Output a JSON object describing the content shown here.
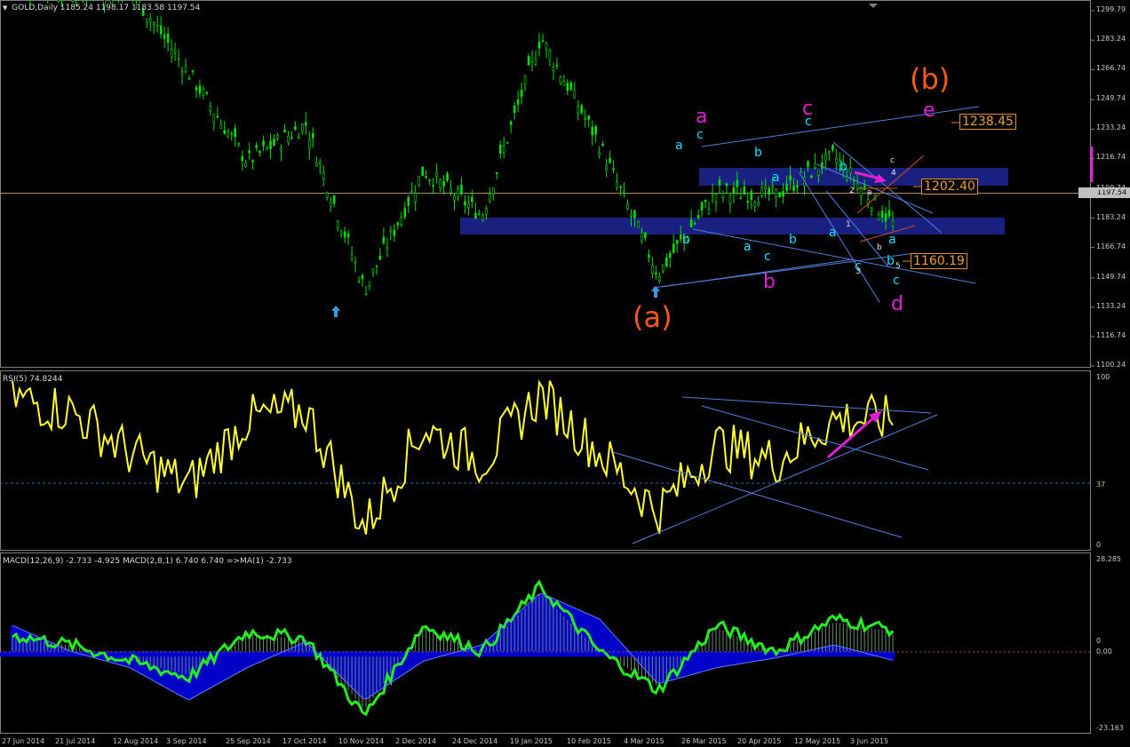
{
  "header": {
    "symbol_label": "GOLD,Daily",
    "ohlc": "1185.24 1198.17 1183.58 1197.54",
    "current_price": "1197.54"
  },
  "price_axis": [
    "1299.79",
    "1283.24",
    "1266.74",
    "1249.74",
    "1233.24",
    "1216.74",
    "1199.74",
    "1183.24",
    "1166.74",
    "1149.74",
    "1133.24",
    "1116.74",
    "1100.24"
  ],
  "date_axis": [
    "27 Jun 2014",
    "21 Jul 2014",
    "12 Aug 2014",
    "3 Sep 2014",
    "25 Sep 2014",
    "17 Oct 2014",
    "10 Nov 2014",
    "2 Dec 2014",
    "24 Dec 2014",
    "19 Jan 2015",
    "10 Feb 2015",
    "4 Mar 2015",
    "26 Mar 2015",
    "20 Apr 2015",
    "12 May 2015",
    "3 Jun 2015"
  ],
  "rsi": {
    "header": "RSI(5) 74.8244",
    "ticks": [
      "100",
      "37",
      "0"
    ]
  },
  "macd": {
    "header": "MACD(12,26,9) -2.733 -4.925  MACD(2,8,1) 6.740 6.740  =>MA(1) -2.733",
    "ticks": [
      "28.285",
      "0",
      "0.00",
      "-23.163"
    ]
  },
  "price_tags": [
    "1238.45",
    "1202.40",
    "1160.19"
  ],
  "annotations": {
    "wave_a_big": "(a)",
    "wave_b_big": "(b)",
    "magenta": [
      "a",
      "c",
      "b",
      "d",
      "e"
    ],
    "cyan": [
      "a",
      "c",
      "b",
      "b",
      "a",
      "a",
      "c",
      "b",
      "c",
      "a",
      "b",
      "c",
      "b",
      "a",
      "c"
    ],
    "small": [
      "c",
      "4",
      "2",
      "a",
      "1",
      "b",
      "3",
      "5"
    ]
  },
  "colors": {
    "candle": "#00e000",
    "rsi": "#ffff33",
    "macd_fast": "#22ee22",
    "macd_hist": "#0000cc",
    "trend": "#4f7fdb",
    "zone": "#1a2080",
    "wave_big": "#ff5a14",
    "wave_magenta": "#e020d0",
    "wave_cyan": "#00e0ff"
  },
  "chart_data": [
    {
      "type": "candlestick",
      "title": "GOLD,Daily",
      "ylim": [
        1100.24,
        1299.79
      ],
      "x": [
        "27 Jun 2014",
        "21 Jul 2014",
        "12 Aug 2014",
        "3 Sep 2014",
        "25 Sep 2014",
        "17 Oct 2014",
        "10 Nov 2014",
        "2 Dec 2014",
        "24 Dec 2014",
        "19 Jan 2015",
        "10 Feb 2015",
        "4 Mar 2015",
        "26 Mar 2015",
        "20 Apr 2015",
        "12 May 2015",
        "3 Jun 2015"
      ],
      "close": [
        1316,
        1310,
        1312,
        1265,
        1215,
        1236,
        1143,
        1210,
        1185,
        1285,
        1225,
        1152,
        1198,
        1196,
        1218,
        1180
      ],
      "last_close": 1197.54
    },
    {
      "type": "line",
      "title": "RSI(5) 74.8244",
      "ylim": [
        0,
        100
      ],
      "x": [
        "27 Jun 2014",
        "21 Jul 2014",
        "12 Aug 2014",
        "3 Sep 2014",
        "25 Sep 2014",
        "17 Oct 2014",
        "10 Nov 2014",
        "2 Dec 2014",
        "24 Dec 2014",
        "19 Jan 2015",
        "10 Feb 2015",
        "4 Mar 2015",
        "26 Mar 2015",
        "20 Apr 2015",
        "12 May 2015",
        "3 Jun 2015"
      ],
      "values": [
        88,
        80,
        55,
        35,
        75,
        80,
        10,
        70,
        50,
        90,
        55,
        20,
        60,
        50,
        75,
        74.82
      ]
    },
    {
      "type": "line",
      "title": "MACD(12,26,9) -2.733 -4.925",
      "ylim": [
        -23.163,
        28.285
      ],
      "x": [
        "27 Jun 2014",
        "21 Jul 2014",
        "12 Aug 2014",
        "3 Sep 2014",
        "25 Sep 2014",
        "17 Oct 2014",
        "10 Nov 2014",
        "2 Dec 2014",
        "24 Dec 2014",
        "19 Jan 2015",
        "10 Feb 2015",
        "4 Mar 2015",
        "26 Mar 2015",
        "20 Apr 2015",
        "12 May 2015",
        "3 Jun 2015"
      ],
      "macd_fast": [
        5,
        2,
        -3,
        -8,
        6,
        4,
        -20,
        8,
        0,
        20,
        0,
        -12,
        8,
        0,
        10,
        6.74
      ],
      "macd_slow": [
        8,
        0,
        -5,
        -15,
        -5,
        3,
        -15,
        -3,
        2,
        18,
        10,
        -10,
        -5,
        -2,
        2,
        -2.733
      ]
    }
  ]
}
